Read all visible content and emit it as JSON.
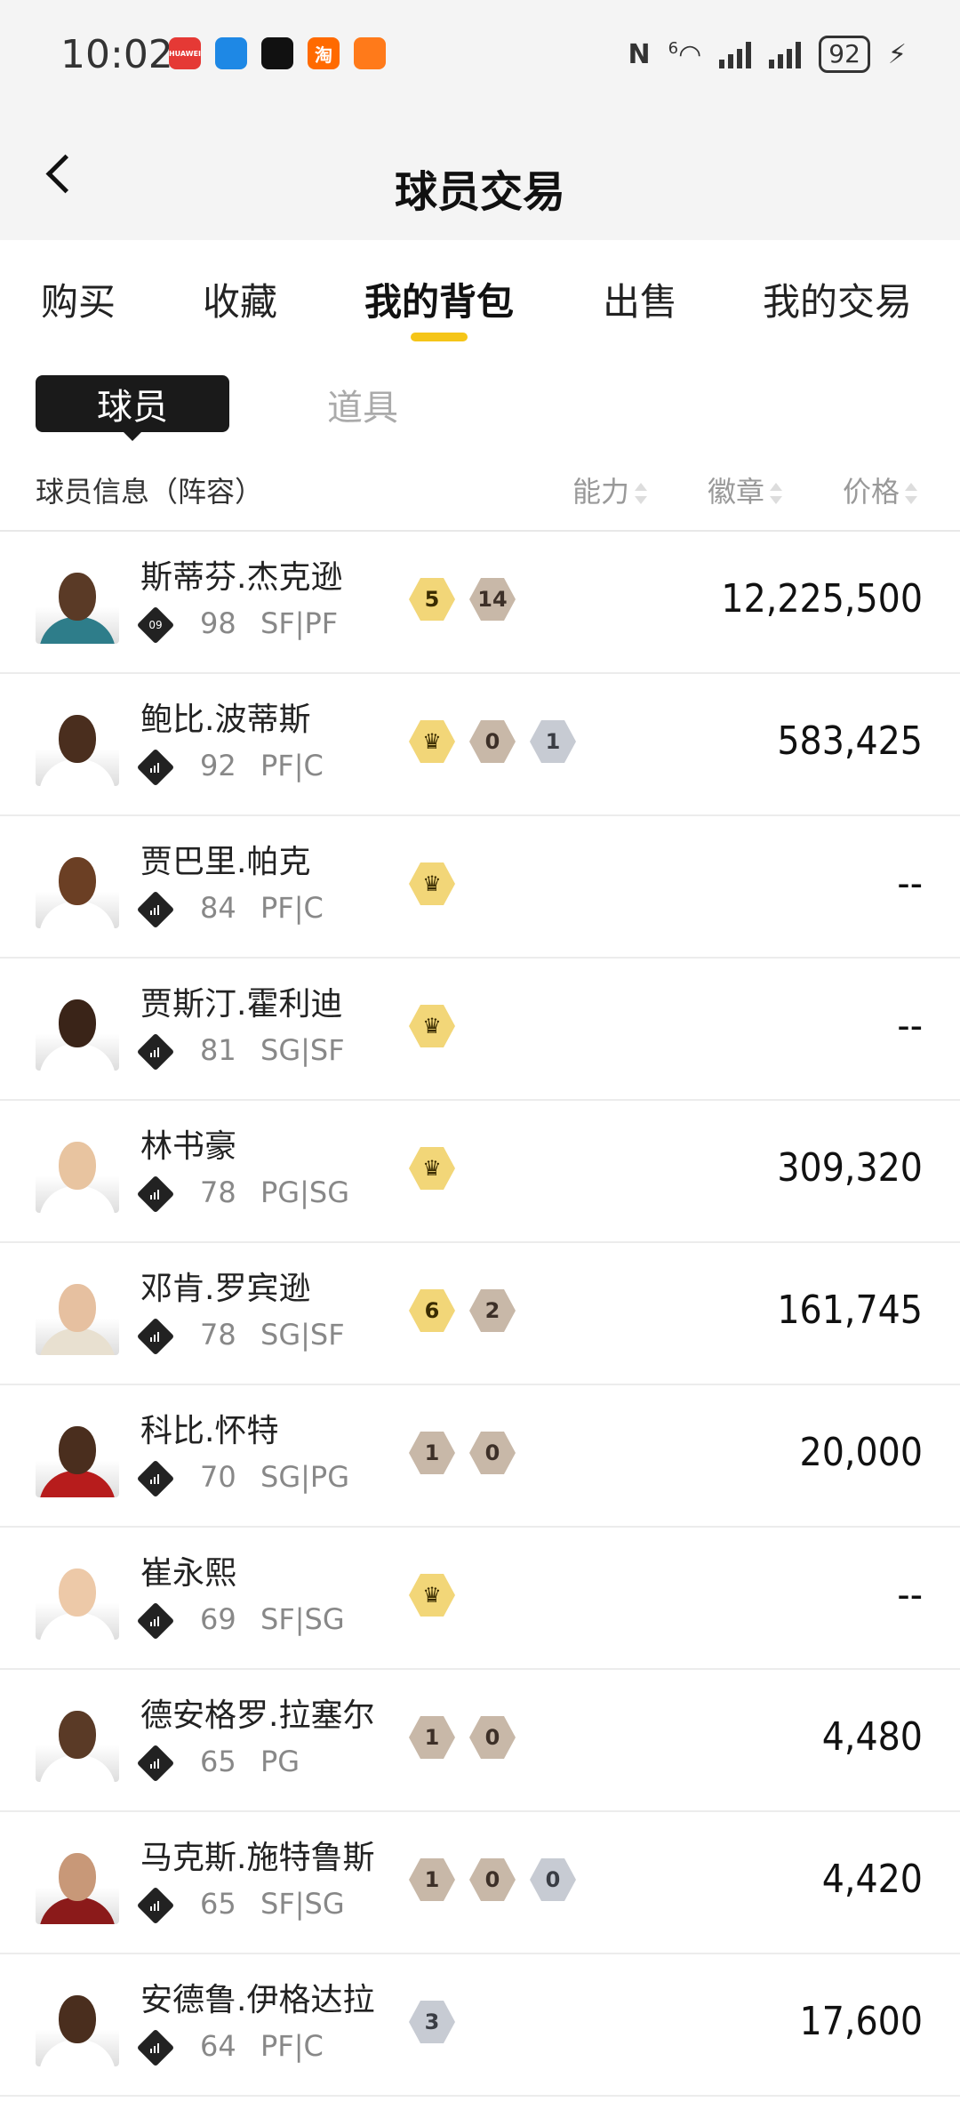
{
  "status_bar": {
    "time": "10:02",
    "apps": [
      {
        "icon": "huawei-icon",
        "label": "HUAWEI",
        "color": "#e53935"
      },
      {
        "icon": "messages-icon",
        "label": "",
        "color": "#1e88e5"
      },
      {
        "icon": "tiktok-icon",
        "label": "",
        "color": "#111111"
      },
      {
        "icon": "taobao-icon",
        "label": "淘",
        "color": "#ff6a00"
      },
      {
        "icon": "app-icon",
        "label": "",
        "color": "#ff7a1a"
      }
    ],
    "network": "6",
    "battery": "92"
  },
  "header": {
    "title": "球员交易"
  },
  "tabs": [
    {
      "label": "购买",
      "active": false
    },
    {
      "label": "收藏",
      "active": false
    },
    {
      "label": "我的背包",
      "active": true
    },
    {
      "label": "出售",
      "active": false
    },
    {
      "label": "我的交易",
      "active": false
    }
  ],
  "subtabs": {
    "active": "球员",
    "inactive": "道具"
  },
  "columns": {
    "info": "球员信息（阵容）",
    "ability": "能力",
    "badge": "徽章",
    "price": "价格"
  },
  "players": [
    {
      "name": "斯蒂芬.杰克逊",
      "rank": "09",
      "rating": "98",
      "position": "SF|PF",
      "badges": [
        {
          "type": "gold",
          "text": "5"
        },
        {
          "type": "bronze",
          "text": "14"
        }
      ],
      "price": "12,225,500",
      "skin": "#5a3a26",
      "jersey": "#2e7d8a"
    },
    {
      "name": "鲍比.波蒂斯",
      "rank": "",
      "rating": "92",
      "position": "PF|C",
      "badges": [
        {
          "type": "gold",
          "text": "♛"
        },
        {
          "type": "bronze",
          "text": "0"
        },
        {
          "type": "silver",
          "text": "1"
        }
      ],
      "price": "583,425",
      "skin": "#4a2e1e",
      "jersey": "#ffffff"
    },
    {
      "name": "贾巴里.帕克",
      "rank": "",
      "rating": "84",
      "position": "PF|C",
      "badges": [
        {
          "type": "gold",
          "text": "♛"
        }
      ],
      "price": "--",
      "skin": "#6b3f24",
      "jersey": "#ffffff"
    },
    {
      "name": "贾斯汀.霍利迪",
      "rank": "",
      "rating": "81",
      "position": "SG|SF",
      "badges": [
        {
          "type": "gold",
          "text": "♛"
        }
      ],
      "price": "--",
      "skin": "#3a2418",
      "jersey": "#ffffff"
    },
    {
      "name": "林书豪",
      "rank": "",
      "rating": "78",
      "position": "PG|SG",
      "badges": [
        {
          "type": "gold",
          "text": "♛"
        }
      ],
      "price": "309,320",
      "skin": "#e8c4a0",
      "jersey": "#ffffff"
    },
    {
      "name": "邓肯.罗宾逊",
      "rank": "",
      "rating": "78",
      "position": "SG|SF",
      "badges": [
        {
          "type": "gold",
          "text": "6"
        },
        {
          "type": "bronze",
          "text": "2"
        }
      ],
      "price": "161,745",
      "skin": "#e6c0a0",
      "jersey": "#e8e0d0"
    },
    {
      "name": "科比.怀特",
      "rank": "",
      "rating": "70",
      "position": "SG|PG",
      "badges": [
        {
          "type": "bronze",
          "text": "1"
        },
        {
          "type": "bronze",
          "text": "0"
        }
      ],
      "price": "20,000",
      "skin": "#4a2e1e",
      "jersey": "#b71c1c"
    },
    {
      "name": "崔永熙",
      "rank": "",
      "rating": "69",
      "position": "SF|SG",
      "badges": [
        {
          "type": "gold",
          "text": "♛"
        }
      ],
      "price": "--",
      "skin": "#edc9a8",
      "jersey": "#ffffff"
    },
    {
      "name": "德安格罗.拉塞尔",
      "rank": "",
      "rating": "65",
      "position": "PG",
      "badges": [
        {
          "type": "bronze",
          "text": "1"
        },
        {
          "type": "bronze",
          "text": "0"
        }
      ],
      "price": "4,480",
      "skin": "#5a3a26",
      "jersey": "#ffffff"
    },
    {
      "name": "马克斯.施特鲁斯",
      "rank": "",
      "rating": "65",
      "position": "SF|SG",
      "badges": [
        {
          "type": "bronze",
          "text": "1"
        },
        {
          "type": "bronze",
          "text": "0"
        },
        {
          "type": "silver",
          "text": "0"
        }
      ],
      "price": "4,420",
      "skin": "#c89878",
      "jersey": "#8b1a1a"
    },
    {
      "name": "安德鲁.伊格达拉",
      "rank": "",
      "rating": "64",
      "position": "PF|C",
      "badges": [
        {
          "type": "silver",
          "text": "3"
        }
      ],
      "price": "17,600",
      "skin": "#4a2e1e",
      "jersey": "#ffffff"
    }
  ]
}
